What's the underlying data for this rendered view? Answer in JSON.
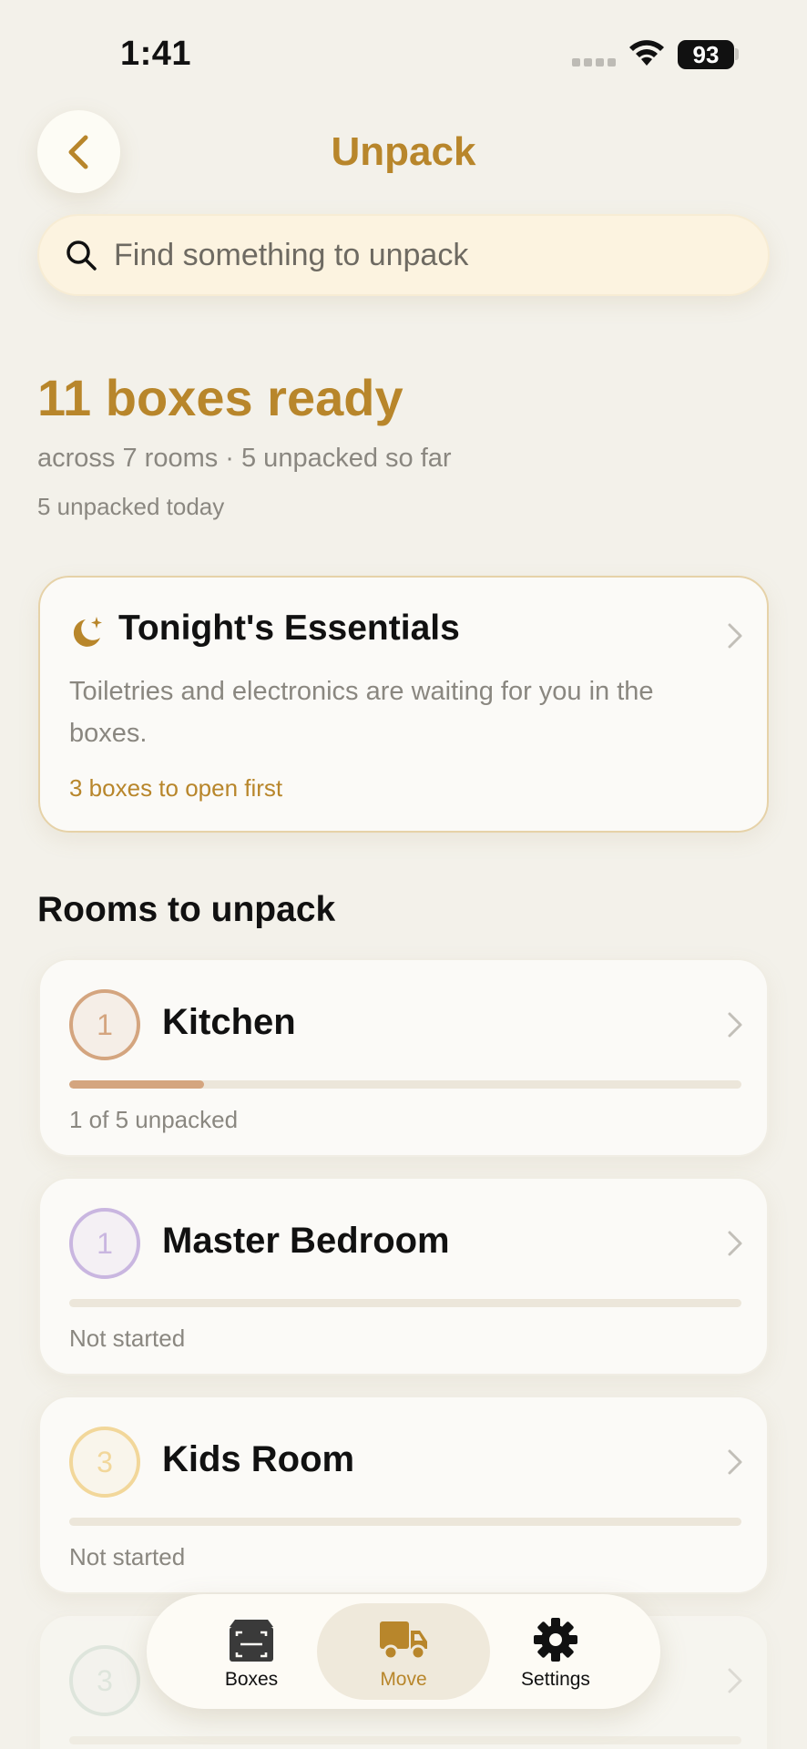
{
  "status_bar": {
    "time": "1:41",
    "battery": "93"
  },
  "header": {
    "title": "Unpack"
  },
  "search": {
    "placeholder": "Find something to unpack"
  },
  "summary": {
    "title": "11 boxes ready",
    "subtitle": "across 7 rooms · 5 unpacked so far",
    "today": "5 unpacked today"
  },
  "essentials": {
    "title": "Tonight's Essentials",
    "description": "Toiletries and electronics are waiting for you in the boxes.",
    "count": "3 boxes to open first"
  },
  "rooms_section": {
    "title": "Rooms to unpack"
  },
  "rooms": [
    {
      "badge": "1",
      "name": "Kitchen",
      "status": "1 of 5 unpacked",
      "progress": 0.2,
      "color": "#d4a57f"
    },
    {
      "badge": "1",
      "name": "Master Bedroom",
      "status": "Not started",
      "progress": 0,
      "color": "#c9b6e0"
    },
    {
      "badge": "3",
      "name": "Kids Room",
      "status": "Not started",
      "progress": 0,
      "color": "#f2d79a"
    },
    {
      "badge": "3",
      "name": "",
      "status": "",
      "progress": 0,
      "color": "#c6d8cc"
    }
  ],
  "tabs": [
    {
      "label": "Boxes",
      "icon": "box-scan-icon",
      "active": false
    },
    {
      "label": "Move",
      "icon": "truck-icon",
      "active": true
    },
    {
      "label": "Settings",
      "icon": "gear-icon",
      "active": false
    }
  ],
  "colors": {
    "accent": "#b8862b",
    "background": "#f3f1ea",
    "card": "#fbfaf7"
  }
}
